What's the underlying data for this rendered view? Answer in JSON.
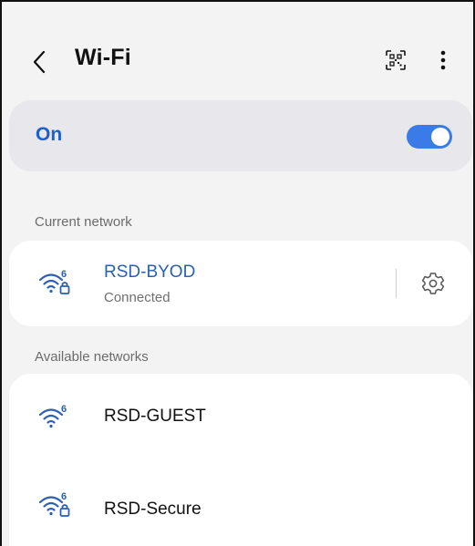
{
  "header": {
    "title": "Wi-Fi",
    "back_icon": "chevron-left-icon",
    "qr_icon": "qr-code-scan-icon",
    "more_icon": "more-vertical-icon"
  },
  "wifi_toggle": {
    "label": "On",
    "state": true,
    "accent_color": "#3b7be8",
    "label_color": "#1e5fcf"
  },
  "current_network": {
    "section_label": "Current network",
    "name": "RSD-BYOD",
    "status": "Connected",
    "wifi_standard": "6",
    "secured": true,
    "settings_icon": "gear-icon"
  },
  "available_networks": {
    "section_label": "Available networks",
    "items": [
      {
        "name": "RSD-GUEST",
        "wifi_standard": "6",
        "secured": false
      },
      {
        "name": "RSD-Secure",
        "wifi_standard": "6",
        "secured": true
      }
    ]
  }
}
